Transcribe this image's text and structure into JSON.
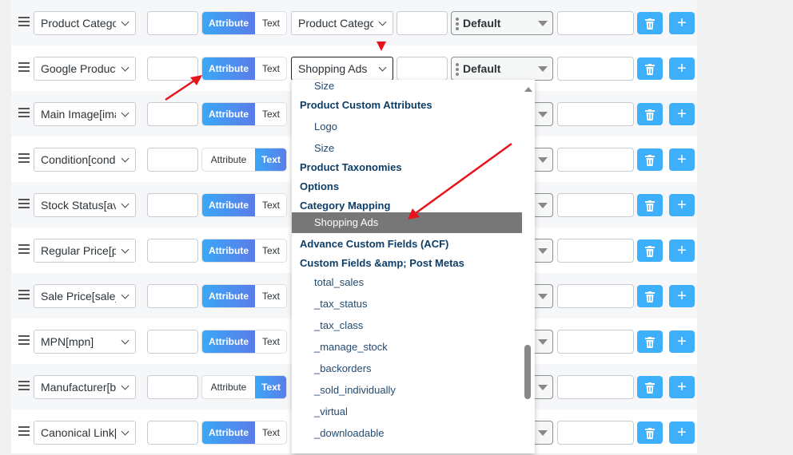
{
  "rows": [
    {
      "field": "Product Categc",
      "toggle": "attribute",
      "value": "Product Categc",
      "default": "Default"
    },
    {
      "field": "Google Product",
      "toggle": "attribute",
      "value": "Shopping Ads",
      "default": "Default"
    },
    {
      "field": "Main Image[ima",
      "toggle": "attribute"
    },
    {
      "field": "Condition[cond",
      "toggle": "text"
    },
    {
      "field": "Stock Status[ava",
      "toggle": "attribute"
    },
    {
      "field": "Regular Price[pr",
      "toggle": "attribute"
    },
    {
      "field": "Sale Price[sale_",
      "toggle": "attribute"
    },
    {
      "field": "MPN[mpn]",
      "toggle": "attribute"
    },
    {
      "field": "Manufacturer[b",
      "toggle": "text"
    },
    {
      "field": "Canonical Link[",
      "toggle": "attribute"
    }
  ],
  "labels": {
    "attribute": "Attribute",
    "text": "Text",
    "default": "Default",
    "delete_icon": "trash-icon",
    "add_icon": "plus-icon"
  },
  "dropdown": {
    "options": [
      {
        "label": "Size",
        "type": "sub"
      },
      {
        "label": "Product Custom Attributes",
        "type": "group"
      },
      {
        "label": "Logo",
        "type": "sub"
      },
      {
        "label": "Size",
        "type": "sub"
      },
      {
        "label": "Product Taxonomies",
        "type": "group"
      },
      {
        "label": "Options",
        "type": "group"
      },
      {
        "label": "Category Mapping",
        "type": "group"
      },
      {
        "label": "Shopping Ads",
        "type": "sub",
        "selected": true
      },
      {
        "label": "Advance Custom Fields (ACF)",
        "type": "group"
      },
      {
        "label": "Custom Fields &amp; Post Metas",
        "type": "group"
      },
      {
        "label": "total_sales",
        "type": "sub"
      },
      {
        "label": "_tax_status",
        "type": "sub"
      },
      {
        "label": "_tax_class",
        "type": "sub"
      },
      {
        "label": "_manage_stock",
        "type": "sub"
      },
      {
        "label": "_backorders",
        "type": "sub"
      },
      {
        "label": "_sold_individually",
        "type": "sub"
      },
      {
        "label": "_virtual",
        "type": "sub"
      },
      {
        "label": "_downloadable",
        "type": "sub"
      }
    ]
  },
  "colors": {
    "toggle_active": "#3aa8f8",
    "button": "#3eb0fb",
    "highlight": "#777777",
    "annotation": "#e8141b"
  }
}
